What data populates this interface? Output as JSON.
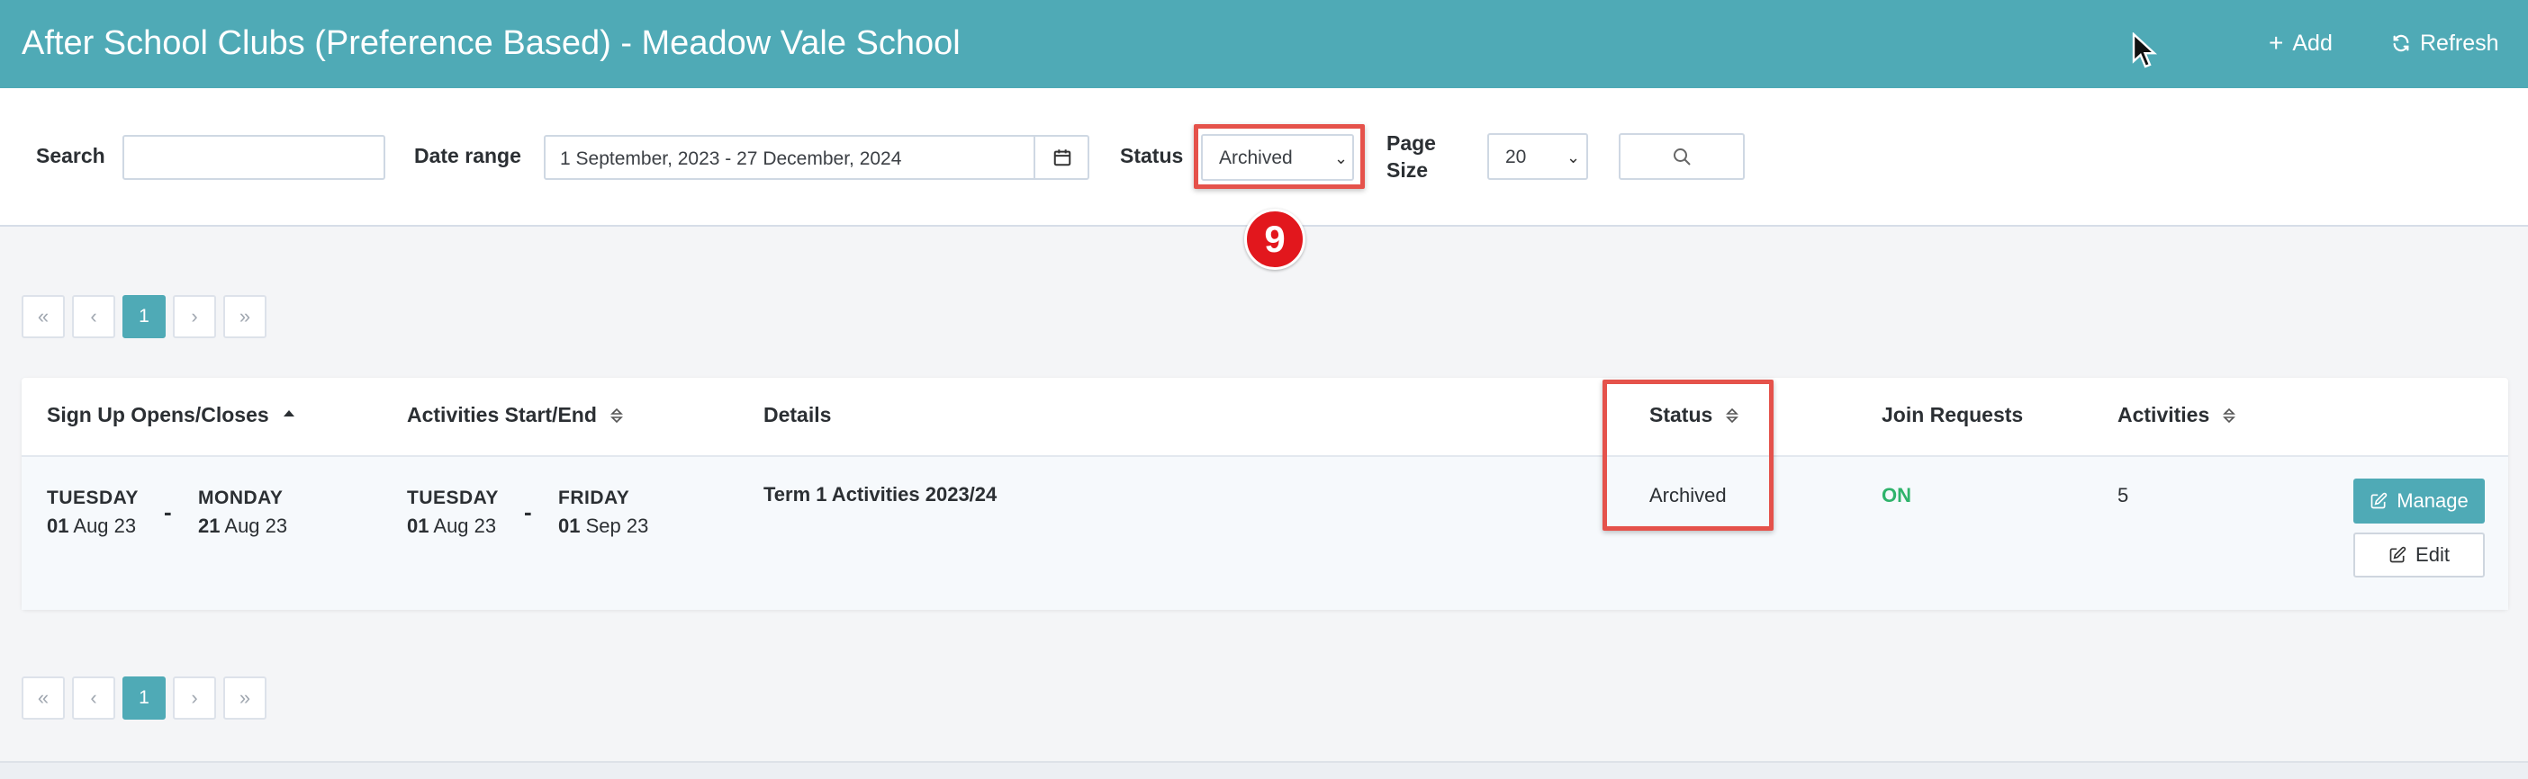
{
  "header": {
    "title": "After School Clubs (Preference Based) - Meadow Vale School",
    "add_label": "Add",
    "refresh_label": "Refresh",
    "background_color": "#4faab6"
  },
  "filters": {
    "search_label": "Search",
    "search_value": "",
    "date_range_label": "Date range",
    "date_range_value": "1 September, 2023 - 27 December, 2024",
    "status_label": "Status",
    "status_value": "Archived",
    "page_size_label_line1": "Page",
    "page_size_label_line2": "Size",
    "page_size_value": "20"
  },
  "annotation": {
    "step_number": "9",
    "highlight_color": "#e5524b"
  },
  "pagination": {
    "first": "«",
    "prev": "‹",
    "current": "1",
    "next": "›",
    "last": "»"
  },
  "table": {
    "columns": {
      "signup": "Sign Up Opens/Closes",
      "activities_period": "Activities Start/End",
      "details": "Details",
      "status": "Status",
      "join_requests": "Join Requests",
      "activities": "Activities"
    },
    "rows": [
      {
        "signup_open_day": "TUESDAY",
        "signup_open_daynum": "01",
        "signup_open_monthyear": "Aug 23",
        "signup_close_day": "MONDAY",
        "signup_close_daynum": "21",
        "signup_close_monthyear": "Aug 23",
        "start_day": "TUESDAY",
        "start_daynum": "01",
        "start_monthyear": "Aug 23",
        "end_day": "FRIDAY",
        "end_daynum": "01",
        "end_monthyear": "Sep 23",
        "details": "Term 1 Activities 2023/24",
        "status": "Archived",
        "join_requests": "ON",
        "activities": "5",
        "manage_label": "Manage",
        "edit_label": "Edit"
      }
    ]
  }
}
